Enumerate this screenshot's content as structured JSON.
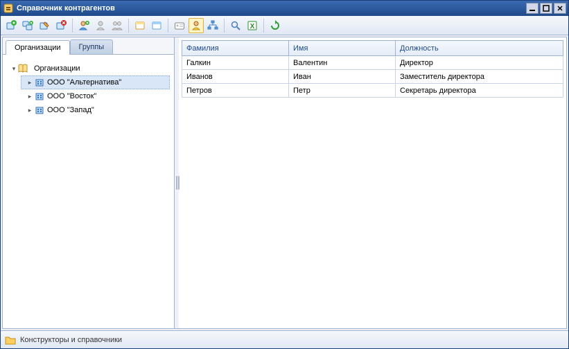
{
  "window": {
    "title": "Справочник контрагентов"
  },
  "toolbar": {
    "items": [
      "add-org",
      "add-sub",
      "edit-org",
      "delete-org",
      "sep",
      "add-contact",
      "add-user",
      "add-group",
      "sep",
      "card1",
      "card2",
      "sep",
      "id-card",
      "highlight-contact",
      "org-chart",
      "sep",
      "search",
      "export-excel",
      "sep",
      "refresh"
    ],
    "active": "highlight-contact"
  },
  "tabs": [
    {
      "id": "orgs",
      "label": "Организации",
      "active": true
    },
    {
      "id": "groups",
      "label": "Группы",
      "active": false
    }
  ],
  "tree": {
    "root": {
      "label": "Организации",
      "expanded": true
    },
    "children": [
      {
        "label": "ООО \"Альтернатива\"",
        "selected": true
      },
      {
        "label": "ООО \"Восток\"",
        "selected": false
      },
      {
        "label": "ООО \"Запад\"",
        "selected": false
      }
    ]
  },
  "grid": {
    "columns": [
      "Фамилия",
      "Имя",
      "Должность"
    ],
    "rows": [
      {
        "c0": "Галкин",
        "c1": "Валентин",
        "c2": "Директор"
      },
      {
        "c0": "Иванов",
        "c1": "Иван",
        "c2": "Заместитель директора"
      },
      {
        "c0": "Петров",
        "c1": "Петр",
        "c2": "Секретарь директора"
      }
    ]
  },
  "footer": {
    "label": "Конструкторы и справочники"
  }
}
